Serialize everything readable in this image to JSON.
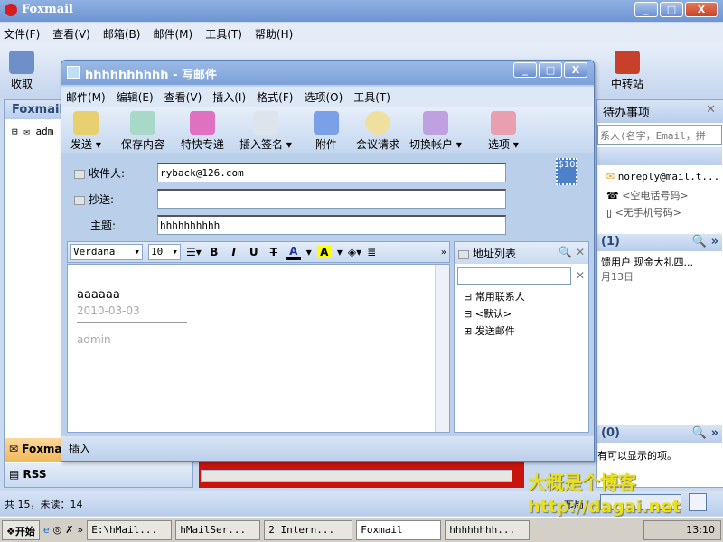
{
  "main": {
    "title": "Foxmail",
    "menu": [
      "文件(F)",
      "查看(V)",
      "邮箱(B)",
      "邮件(M)",
      "工具(T)",
      "帮助(H)"
    ],
    "toolbar": {
      "receive": "收取",
      "relay": "中转站"
    },
    "left": {
      "header": "Foxmail",
      "account": "adm",
      "tab_foxmail": "Foxmail",
      "tab_rss": "RSS"
    },
    "right": {
      "todo_header": "待办事项",
      "search_placeholder": "系人(名字，Email，拼",
      "contact_email": "noreply@mail.t...",
      "phone": "<空电话号码>",
      "mobile": "<无手机号码>",
      "section1": "(1)",
      "item1": "馈用户 现金大礼四...",
      "item1_date": "月13日",
      "section2": "(0)",
      "empty": "有可以显示的项。"
    },
    "status": {
      "count": "共 15，未读：14",
      "layout": "布局："
    }
  },
  "compose": {
    "title": "hhhhhhhhhh - 写邮件",
    "menu": [
      "邮件(M)",
      "编辑(E)",
      "查看(V)",
      "插入(I)",
      "格式(F)",
      "选项(O)",
      "工具(T)"
    ],
    "toolbar": [
      "发送",
      "保存内容",
      "特快专递",
      "插入签名",
      "附件",
      "会议请求",
      "切换帐户",
      "选项"
    ],
    "to_label": "收件人:",
    "to": "ryback@126.com",
    "cc_label": "抄送:",
    "cc": "",
    "subject_label": "主题:",
    "subject": "hhhhhhhhhh",
    "stamp": "$10",
    "font": "Verdana",
    "size": "10",
    "body": {
      "text": "aaaaaa",
      "date": "2010-03-03",
      "sig": "admin"
    },
    "addr": {
      "title": "地址列表",
      "groups": [
        "常用联系人",
        "<默认>",
        "发送邮件"
      ]
    },
    "status": "插入"
  },
  "watermark": {
    "line1": "大概是个博客",
    "line2": "http://dagai.net"
  },
  "taskbar": {
    "start": "开始",
    "items": [
      "E:\\hMail...",
      "hMailSer...",
      "2 Intern...",
      "Foxmail",
      "hhhhhhhh..."
    ],
    "clock": "13:10"
  }
}
